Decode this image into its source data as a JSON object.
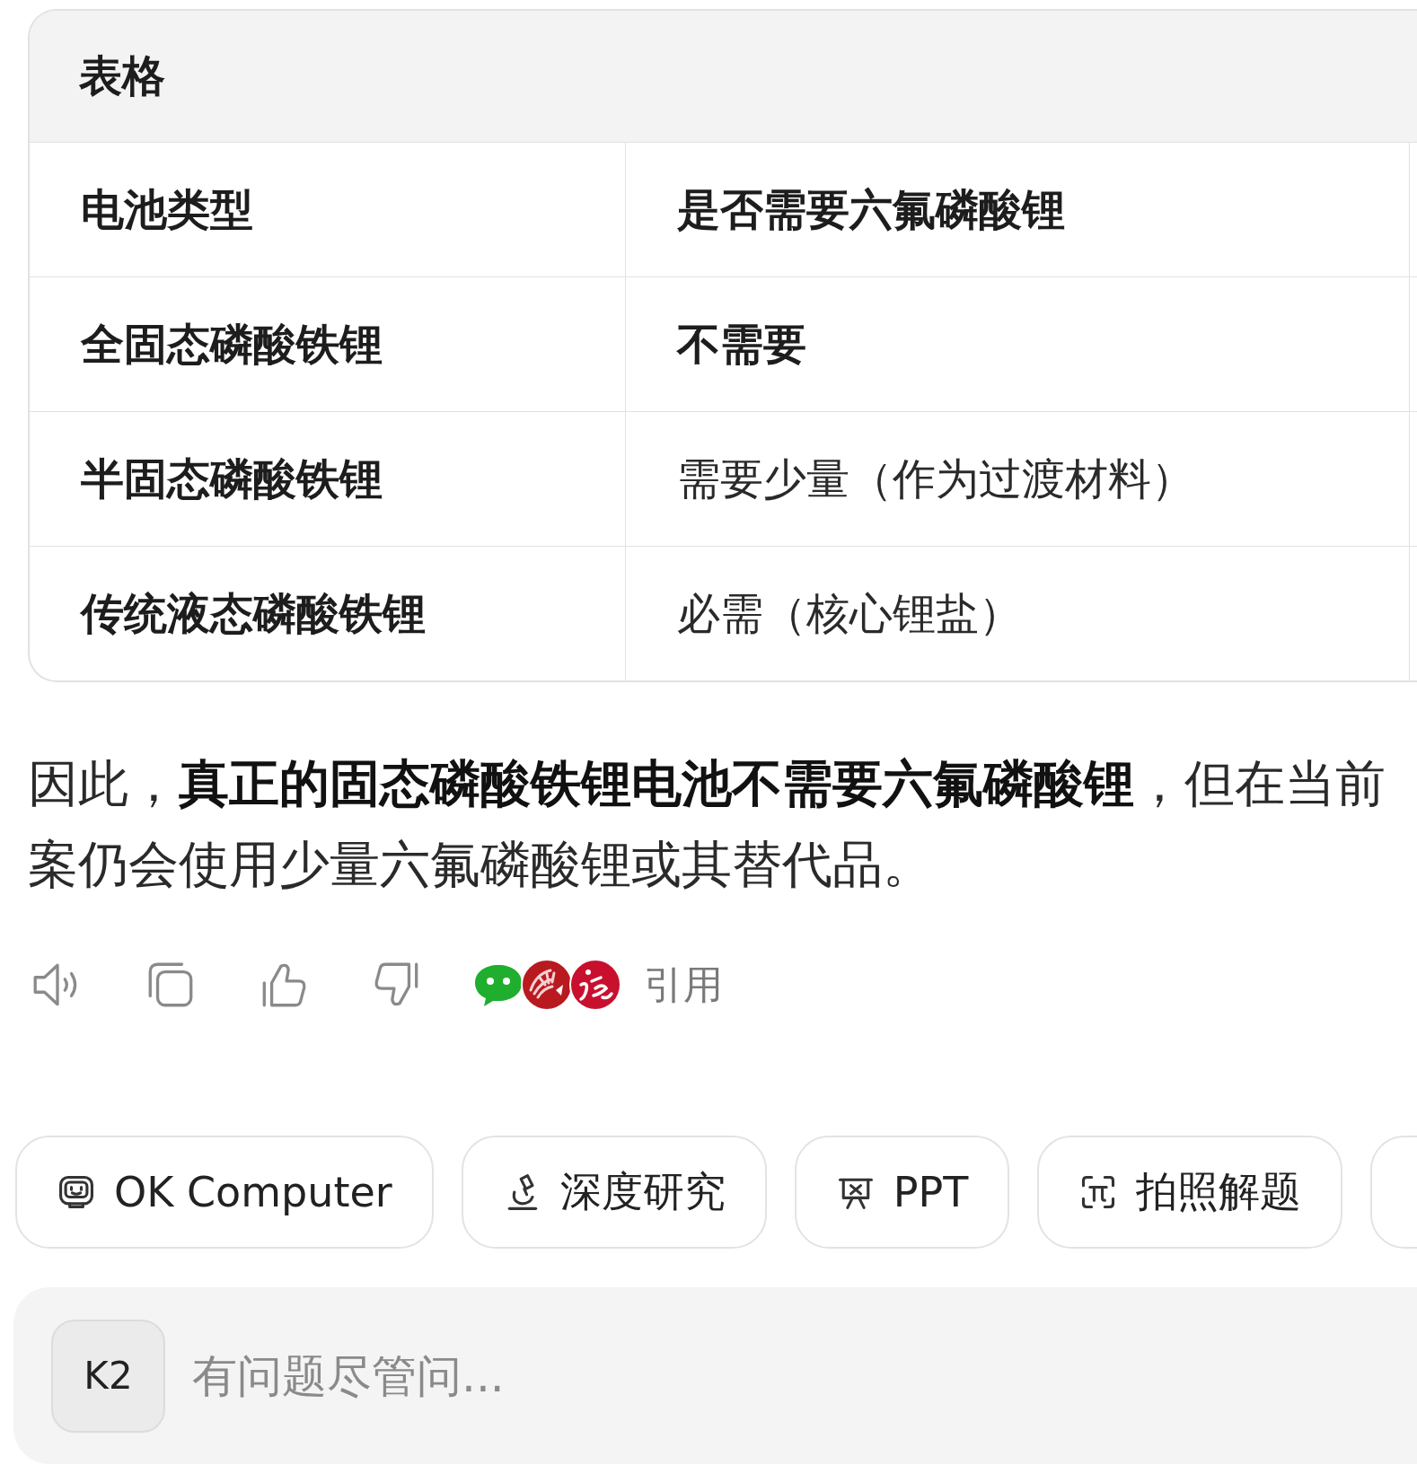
{
  "table": {
    "title": "表格",
    "rows": [
      [
        {
          "text": "电池类型",
          "bold": true
        },
        {
          "text": "是否需要六氟磷酸锂",
          "bold": true
        }
      ],
      [
        {
          "text": "全固态磷酸铁锂",
          "bold": true
        },
        {
          "text": "不需要",
          "bold": true
        }
      ],
      [
        {
          "text": "半固态磷酸铁锂",
          "bold": true
        },
        {
          "text": "需要少量（作为过渡材料）",
          "bold": false
        }
      ],
      [
        {
          "text": "传统液态磷酸铁锂",
          "bold": true
        },
        {
          "text": "必需（核心锂盐）",
          "bold": false
        }
      ]
    ]
  },
  "answer": {
    "lines": [
      "因此，**真正的固态磷酸铁锂电池不需要六氟磷酸锂**，但在当前",
      "案仍会使用少量六氟磷酸锂或其替代品。"
    ]
  },
  "citation": {
    "sources": [
      {
        "kind": "chat"
      },
      {
        "kind": "fan"
      },
      {
        "kind": "swirl"
      }
    ],
    "label": "引用"
  },
  "shortcuts": [
    {
      "kind": "computer",
      "label": "OK Computer"
    },
    {
      "kind": "research",
      "label": "深度研究"
    },
    {
      "kind": "ppt",
      "label": "PPT"
    },
    {
      "kind": "photo",
      "label": "拍照解题"
    },
    {
      "kind": "cut-off"
    }
  ],
  "composer": {
    "model": "K2",
    "placeholder": "有问题尽管问..."
  }
}
